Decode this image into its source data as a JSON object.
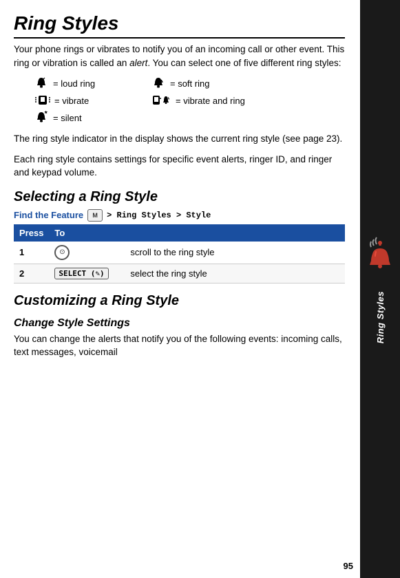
{
  "page": {
    "title": "Ring Styles",
    "page_number": "95"
  },
  "intro": {
    "paragraph": "Your phone rings or vibrates to notify you of an incoming call or other event. This ring or vibration is called an alert. You can select one of five different ring styles:"
  },
  "icons": [
    {
      "symbol": "🔔¹",
      "label": "= loud ring",
      "css_icon": "loud"
    },
    {
      "symbol": "🔔",
      "label": "= soft ring",
      "css_icon": "soft"
    },
    {
      "symbol": "📳",
      "label": "= vibrate",
      "css_icon": "vibrate"
    },
    {
      "symbol": "📳🔔",
      "label": "= vibrate and ring",
      "css_icon": "viband"
    },
    {
      "symbol": "🔕",
      "label": "= silent",
      "css_icon": "silent"
    }
  ],
  "ring_indicator_text": "The ring style indicator in the display shows the current ring style (see page 23).",
  "ring_settings_text": "Each ring style contains settings for specific event alerts, ringer ID, and ringer and keypad volume.",
  "selecting_section": {
    "heading": "Selecting a Ring Style",
    "find_feature_label": "Find the Feature",
    "find_feature_path": "> Ring Styles > Style",
    "table": {
      "col_press": "Press",
      "col_to": "To",
      "rows": [
        {
          "step": "1",
          "press": "NAV",
          "to": "scroll to the ring style"
        },
        {
          "step": "2",
          "press": "SELECT (✎)",
          "to": "select the ring style"
        }
      ]
    }
  },
  "customizing_section": {
    "heading": "Customizing a Ring Style",
    "sub_heading": "Change Style Settings",
    "paragraph": "You can change the alerts that notify you of the following events: incoming calls, text messages, voicemail"
  },
  "sidebar": {
    "label": "Ring Styles"
  }
}
